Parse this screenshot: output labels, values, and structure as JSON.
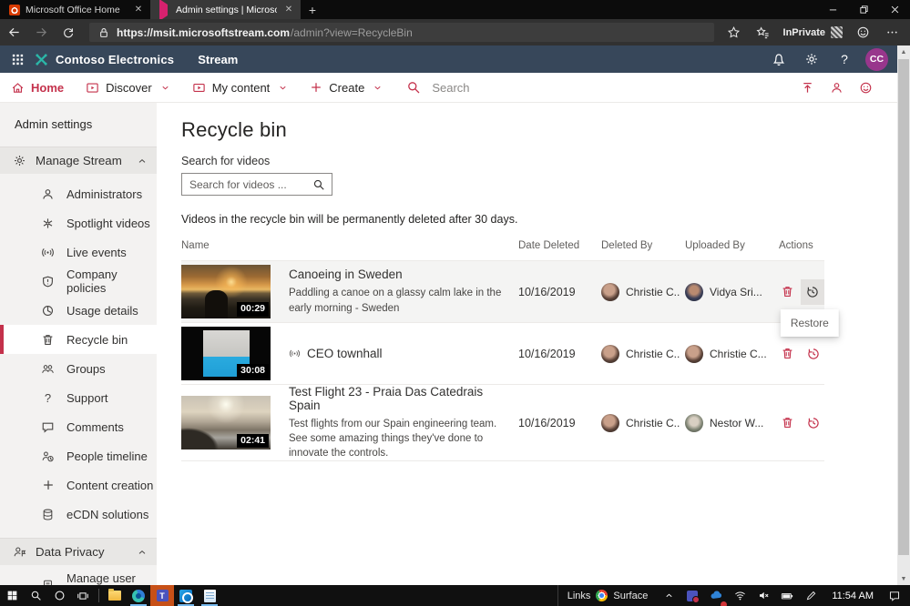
{
  "browser": {
    "tabs": [
      {
        "title": "Microsoft Office Home"
      },
      {
        "title": "Admin settings | Microsoft Strea"
      }
    ],
    "new_tab": "+",
    "address": {
      "url_host": "https://msit.microsoftstream.com",
      "url_path": "/admin?view=RecycleBin",
      "inprivate": "InPrivate"
    }
  },
  "stream_header": {
    "org": "Contoso Electronics",
    "app": "Stream",
    "avatar_initials": "CC"
  },
  "stream_nav": {
    "home": "Home",
    "discover": "Discover",
    "my_content": "My content",
    "create": "Create",
    "search_placeholder": "Search"
  },
  "sidebar": {
    "title": "Admin settings",
    "manage_stream": {
      "label": "Manage Stream"
    },
    "manage_items": [
      {
        "label": "Administrators"
      },
      {
        "label": "Spotlight videos"
      },
      {
        "label": "Live events"
      },
      {
        "label": "Company policies"
      },
      {
        "label": "Usage details"
      },
      {
        "label": "Recycle bin"
      },
      {
        "label": "Groups"
      },
      {
        "label": "Support"
      },
      {
        "label": "Comments"
      },
      {
        "label": "People timeline"
      },
      {
        "label": "Content creation"
      },
      {
        "label": "eCDN solutions"
      }
    ],
    "data_privacy": {
      "label": "Data Privacy"
    },
    "privacy_items": [
      {
        "label": "Manage user data"
      }
    ]
  },
  "main": {
    "title": "Recycle bin",
    "search_label": "Search for videos",
    "search_placeholder": "Search for videos ...",
    "notice": "Videos in the recycle bin will be permanently deleted after 30 days.",
    "columns": {
      "name": "Name",
      "date": "Date Deleted",
      "deleted_by": "Deleted By",
      "uploaded_by": "Uploaded By",
      "actions": "Actions"
    },
    "rows": [
      {
        "title": "Canoeing in Sweden",
        "description": "Paddling a canoe on a glassy calm lake in the early morning - Sweden",
        "duration": "00:29",
        "date": "10/16/2019",
        "deleted_by": "Christie C...",
        "uploaded_by": "Vidya Sri..."
      },
      {
        "title": "CEO townhall",
        "description": "",
        "duration": "30:08",
        "date": "10/16/2019",
        "deleted_by": "Christie C...",
        "uploaded_by": "Christie C..."
      },
      {
        "title": "Test Flight 23 - Praia Das Catedrais Spain",
        "description": "Test flights from our Spain engineering team. See some amazing things they've done to innovate the controls.",
        "duration": "02:41",
        "date": "10/16/2019",
        "deleted_by": "Christie C...",
        "uploaded_by": "Nestor W..."
      }
    ],
    "restore_tooltip": "Restore"
  },
  "taskbar": {
    "links": "Links",
    "surface": "Surface",
    "time": "11:54 AM"
  },
  "icons": {
    "app_launcher": "waffle-grid",
    "notifications": "bell",
    "settings": "gear",
    "help": "?",
    "upload": "up-arrow",
    "delete": "trash-can",
    "restore": "history-clock",
    "search": "magnifier"
  },
  "colors": {
    "accent": "#c4314b",
    "header_bg": "#37475a",
    "avatar_bg": "#98368c"
  }
}
